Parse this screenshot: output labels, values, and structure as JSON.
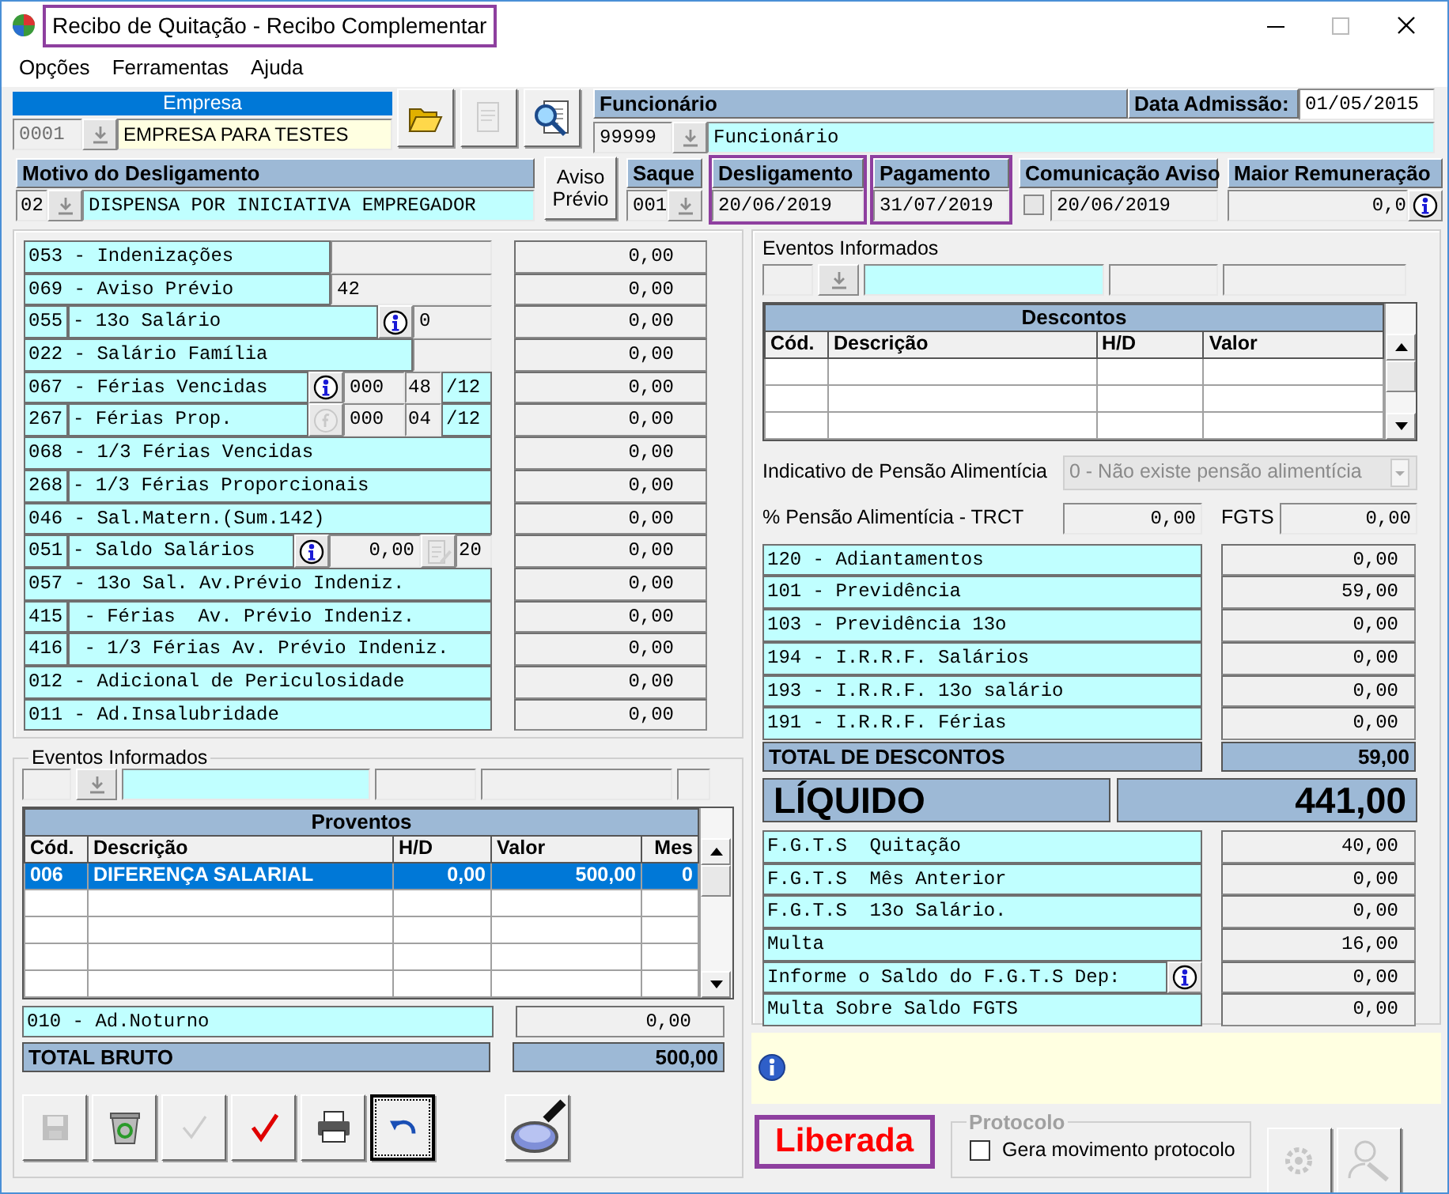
{
  "window": {
    "title": "Recibo de Quitação - Recibo Complementar",
    "highlighted": true
  },
  "menu": [
    {
      "label": "Opções"
    },
    {
      "label": "Ferramentas"
    },
    {
      "label": "Ajuda"
    }
  ],
  "empresa": {
    "label": "Empresa",
    "code": "0001",
    "name": "EMPRESA PARA TESTES"
  },
  "top_buttons": [
    {
      "kind": "open",
      "disabled": false
    },
    {
      "kind": "document",
      "disabled": true
    },
    {
      "kind": "preview",
      "disabled": false
    }
  ],
  "funcionario": {
    "label": "Funcionário",
    "code": "99999",
    "name": "Funcionário"
  },
  "data_admissao": {
    "label": "Data Admissão:",
    "value": "01/05/2015"
  },
  "motivo": {
    "label": "Motivo do Desligamento",
    "code": "02",
    "value": "DISPENSA POR INICIATIVA EMPREGADOR"
  },
  "aviso_previo_button": "Aviso Prévio",
  "saque": {
    "label": "Saque",
    "value": "001"
  },
  "desligamento": {
    "label": "Desligamento",
    "value": "20/06/2019",
    "highlighted": true
  },
  "pagamento": {
    "label": "Pagamento",
    "value": "31/07/2019",
    "highlighted": true
  },
  "comunicacao_aviso": {
    "label": "Comunicação Aviso",
    "value": "20/06/2019",
    "checked": false
  },
  "maior_remuneracao": {
    "label": "Maior Remuneração",
    "value": "0,0"
  },
  "proventos_fields": [
    {
      "kind": "merged",
      "text": "053 - Indenizações",
      "widgets": [
        {
          "kind": "wide-input"
        }
      ],
      "value": "0,00"
    },
    {
      "kind": "merged",
      "text": "069 - Aviso Prévio",
      "widgets": [
        {
          "kind": "wide-input",
          "value": "42"
        }
      ],
      "value": "0,00"
    },
    {
      "kind": "split",
      "code": "055",
      "text": "- 13o Salário",
      "widgets": [
        {
          "kind": "info-button",
          "disabled": false
        },
        {
          "kind": "input",
          "value": "0"
        }
      ],
      "value": "0,00"
    },
    {
      "kind": "merged",
      "text": "022 - Salário Família",
      "widgets": [
        {
          "kind": "input"
        }
      ],
      "value": "0,00"
    },
    {
      "kind": "merged",
      "text": "067 - Férias Vencidas",
      "widgets": [
        {
          "kind": "info-button",
          "disabled": false
        },
        {
          "kind": "count-input",
          "value": "000"
        },
        {
          "kind": "short-input",
          "value": "48"
        },
        {
          "kind": "unit",
          "value": "/12"
        }
      ],
      "value": "0,00"
    },
    {
      "kind": "split",
      "code": "267",
      "text": "- Férias Prop.",
      "widgets": [
        {
          "kind": "f-button",
          "disabled": true
        },
        {
          "kind": "count-input",
          "value": "000"
        },
        {
          "kind": "short-input",
          "value": "04"
        },
        {
          "kind": "unit",
          "value": "/12"
        }
      ],
      "value": "0,00"
    },
    {
      "kind": "merged",
      "text": "068 - 1/3 Férias Vencidas",
      "value": "0,00"
    },
    {
      "kind": "split",
      "code": "268",
      "text": "- 1/3 Férias Proporcionais",
      "value": "0,00"
    },
    {
      "kind": "merged",
      "text": "046 - Sal.Matern.(Sum.142)",
      "value": "0,00"
    },
    {
      "kind": "split",
      "code": "051",
      "text": "- Saldo Salários",
      "widgets": [
        {
          "kind": "info-button",
          "disabled": false
        },
        {
          "kind": "amount-input",
          "value": "0,00"
        },
        {
          "kind": "calc-button",
          "disabled": true
        },
        {
          "kind": "short-input",
          "value": "20"
        }
      ],
      "value": "0,00"
    },
    {
      "kind": "merged",
      "text": "057 - 13o Sal. Av.Prévio Indeniz.",
      "value": "0,00"
    },
    {
      "kind": "split",
      "code": "415",
      "text": " - Férias  Av. Prévio Indeniz.",
      "value": "0,00"
    },
    {
      "kind": "split",
      "code": "416",
      "text": " - 1/3 Férias Av. Prévio Indeniz.",
      "value": "0,00"
    },
    {
      "kind": "merged",
      "text": "012 - Adicional de Periculosidade",
      "value": "0,00"
    },
    {
      "kind": "merged",
      "text": "011 - Ad.Insalubridade",
      "value": "0,00"
    }
  ],
  "eventos_proventos": {
    "label": "Eventos Informados"
  },
  "proventos_table": {
    "title": "Proventos",
    "columns": [
      "Cód.",
      "Descrição",
      "H/D",
      "Valor",
      "Mes"
    ],
    "rows": [
      {
        "cells": [
          "006",
          "DIFERENÇA SALARIAL",
          "0,00",
          "500,00",
          "0"
        ],
        "selected": true
      }
    ]
  },
  "ad_noturno": {
    "text": "010 - Ad.Noturno",
    "value": "0,00"
  },
  "total_bruto": {
    "label": "TOTAL BRUTO",
    "value": "500,00"
  },
  "bottom_buttons": [
    {
      "kind": "save",
      "disabled": true,
      "focused": false
    },
    {
      "kind": "delete",
      "disabled": false,
      "focused": false
    },
    {
      "kind": "confirm",
      "disabled": true,
      "focused": false
    },
    {
      "kind": "approve",
      "disabled": false,
      "focused": false
    },
    {
      "kind": "print",
      "disabled": false,
      "focused": false
    },
    {
      "kind": "undo",
      "disabled": false,
      "focused": true
    },
    {
      "kind": "search",
      "disabled": false,
      "focused": false
    }
  ],
  "eventos_descontos": {
    "label": "Eventos Informados"
  },
  "descontos_table": {
    "title": "Descontos",
    "columns": [
      "Cód.",
      "Descrição",
      "H/D",
      "Valor"
    ]
  },
  "pensao": {
    "label": "Indicativo de Pensão Alimentícia",
    "value": "0 - Não existe pensão alimentícia",
    "disabled": true
  },
  "pensao_pct": {
    "label": "% Pensão Alimentícia - TRCT",
    "value": "0,00"
  },
  "fgts": {
    "label": "FGTS",
    "value": "0,00"
  },
  "descontos_fields": [
    {
      "text": "120 - Adiantamentos",
      "value": "0,00"
    },
    {
      "text": "101 - Previdência",
      "value": "59,00"
    },
    {
      "text": "103 - Previdência 13o",
      "value": "0,00"
    },
    {
      "text": "194 - I.R.R.F. Salários",
      "value": "0,00"
    },
    {
      "text": "193 - I.R.R.F. 13o salário",
      "value": "0,00"
    },
    {
      "text": "191 - I.R.R.F. Férias",
      "value": "0,00"
    }
  ],
  "total_descontos": {
    "label": "TOTAL DE DESCONTOS",
    "value": "59,00"
  },
  "liquido": {
    "label": "LÍQUIDO",
    "value": "441,00"
  },
  "fgts_fields": [
    {
      "kind": "plain",
      "text": "F.G.T.S  Quitação",
      "value": "40,00"
    },
    {
      "kind": "plain",
      "text": "F.G.T.S  Mês Anterior",
      "value": "0,00"
    },
    {
      "kind": "plain",
      "text": "F.G.T.S  13o Salário.",
      "value": "0,00"
    },
    {
      "kind": "plain",
      "text": "Multa",
      "value": "16,00"
    },
    {
      "kind": "info",
      "text": "Informe o Saldo do F.G.T.S Dep:",
      "value": "0,00"
    },
    {
      "kind": "plain",
      "text": "Multa Sobre Saldo FGTS",
      "value": "0,00"
    }
  ],
  "status": {
    "label": "Liberada",
    "highlighted": true
  },
  "protocolo": {
    "legend": "Protocolo",
    "disabled": true,
    "checkbox": {
      "label": "Gera movimento protocolo",
      "checked": false
    }
  },
  "side_buttons": [
    {
      "kind": "settings",
      "disabled": true
    },
    {
      "kind": "tool",
      "disabled": true
    }
  ]
}
